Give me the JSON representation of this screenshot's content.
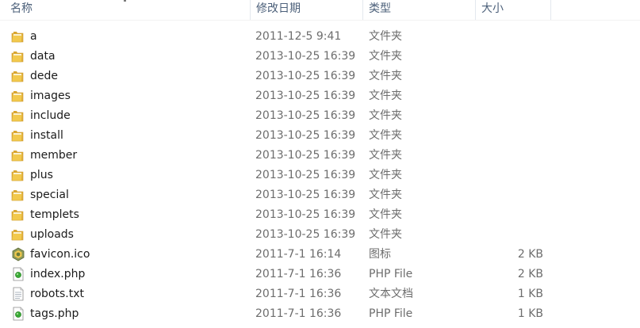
{
  "header": {
    "columns": {
      "name": "名称",
      "date": "修改日期",
      "type": "类型",
      "size": "大小"
    }
  },
  "files": [
    {
      "name": "a",
      "date": "2011-12-5 9:41",
      "type": "文件夹",
      "size": "",
      "icon": "folder-icon"
    },
    {
      "name": "data",
      "date": "2013-10-25 16:39",
      "type": "文件夹",
      "size": "",
      "icon": "folder-icon"
    },
    {
      "name": "dede",
      "date": "2013-10-25 16:39",
      "type": "文件夹",
      "size": "",
      "icon": "folder-icon"
    },
    {
      "name": "images",
      "date": "2013-10-25 16:39",
      "type": "文件夹",
      "size": "",
      "icon": "folder-icon"
    },
    {
      "name": "include",
      "date": "2013-10-25 16:39",
      "type": "文件夹",
      "size": "",
      "icon": "folder-icon"
    },
    {
      "name": "install",
      "date": "2013-10-25 16:39",
      "type": "文件夹",
      "size": "",
      "icon": "folder-icon"
    },
    {
      "name": "member",
      "date": "2013-10-25 16:39",
      "type": "文件夹",
      "size": "",
      "icon": "folder-icon"
    },
    {
      "name": "plus",
      "date": "2013-10-25 16:39",
      "type": "文件夹",
      "size": "",
      "icon": "folder-icon"
    },
    {
      "name": "special",
      "date": "2013-10-25 16:39",
      "type": "文件夹",
      "size": "",
      "icon": "folder-icon"
    },
    {
      "name": "templets",
      "date": "2013-10-25 16:39",
      "type": "文件夹",
      "size": "",
      "icon": "folder-icon"
    },
    {
      "name": "uploads",
      "date": "2013-10-25 16:39",
      "type": "文件夹",
      "size": "",
      "icon": "folder-icon"
    },
    {
      "name": "favicon.ico",
      "date": "2011-7-1 16:14",
      "type": "图标",
      "size": "2 KB",
      "icon": "favicon-icon"
    },
    {
      "name": "index.php",
      "date": "2011-7-1 16:36",
      "type": "PHP File",
      "size": "2 KB",
      "icon": "php-file-icon"
    },
    {
      "name": "robots.txt",
      "date": "2011-7-1 16:36",
      "type": "文本文档",
      "size": "1 KB",
      "icon": "text-file-icon"
    },
    {
      "name": "tags.php",
      "date": "2011-7-1 16:36",
      "type": "PHP File",
      "size": "1 KB",
      "icon": "php-file-icon"
    }
  ],
  "colors": {
    "header_text": "#4c607a",
    "folder_yellow": "#f2c94c",
    "php_green": "#39a935"
  }
}
